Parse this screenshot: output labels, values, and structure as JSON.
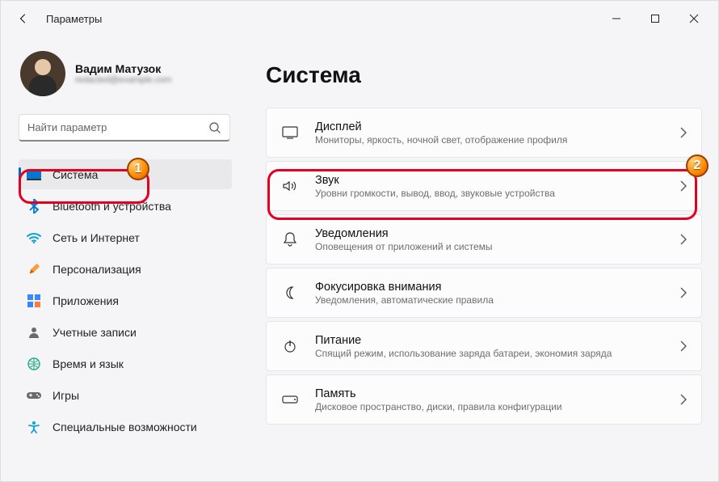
{
  "window": {
    "title": "Параметры"
  },
  "user": {
    "name": "Вадим Матузок",
    "email": "redacted@example.com"
  },
  "search": {
    "placeholder": "Найти параметр"
  },
  "sidebar": {
    "items": [
      {
        "label": "Система"
      },
      {
        "label": "Bluetooth и устройства"
      },
      {
        "label": "Сеть и Интернет"
      },
      {
        "label": "Персонализация"
      },
      {
        "label": "Приложения"
      },
      {
        "label": "Учетные записи"
      },
      {
        "label": "Время и язык"
      },
      {
        "label": "Игры"
      },
      {
        "label": "Специальные возможности"
      }
    ]
  },
  "main": {
    "heading": "Система",
    "cards": [
      {
        "title": "Дисплей",
        "sub": "Мониторы, яркость, ночной свет, отображение профиля"
      },
      {
        "title": "Звук",
        "sub": "Уровни громкости, вывод, ввод, звуковые устройства"
      },
      {
        "title": "Уведомления",
        "sub": "Оповещения от приложений и системы"
      },
      {
        "title": "Фокусировка внимания",
        "sub": "Уведомления, автоматические правила"
      },
      {
        "title": "Питание",
        "sub": "Спящий режим, использование заряда батареи, экономия заряда"
      },
      {
        "title": "Память",
        "sub": "Дисковое пространство, диски, правила конфигурации"
      }
    ]
  },
  "annotations": {
    "badge1": "1",
    "badge2": "2"
  }
}
